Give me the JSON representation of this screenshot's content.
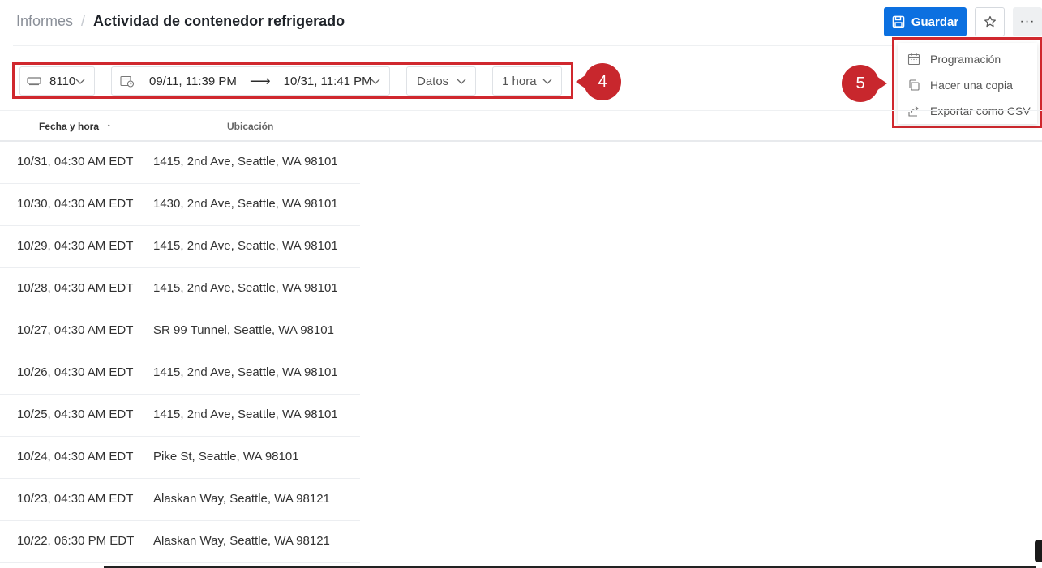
{
  "breadcrumb": {
    "root": "Informes",
    "separator": "/",
    "title": "Actividad de contenedor refrigerado"
  },
  "header": {
    "save_label": "Guardar",
    "more_label": "···"
  },
  "filters": {
    "vehicle": "8110",
    "date_from": "09/11, 11:39 PM",
    "arrow": "⟶",
    "date_to": "10/31, 11:41 PM",
    "data": "Datos",
    "interval": "1 hora"
  },
  "callouts": {
    "four": "4",
    "five": "5"
  },
  "menu": {
    "items": [
      {
        "label": "Programación",
        "icon": "calendar-icon"
      },
      {
        "label": "Hacer una copia",
        "icon": "copy-icon"
      },
      {
        "label": "Exportar como CSV",
        "icon": "export-icon"
      }
    ]
  },
  "table": {
    "columns": {
      "date": "Fecha y hora",
      "sort_arrow": "↑",
      "location": "Ubicación"
    },
    "rows": [
      {
        "date": "10/31, 04:30 AM EDT",
        "location": "1415, 2nd Ave, Seattle, WA 98101"
      },
      {
        "date": "10/30, 04:30 AM EDT",
        "location": "1430, 2nd Ave, Seattle, WA 98101"
      },
      {
        "date": "10/29, 04:30 AM EDT",
        "location": "1415, 2nd Ave, Seattle, WA 98101"
      },
      {
        "date": "10/28, 04:30 AM EDT",
        "location": "1415, 2nd Ave, Seattle, WA 98101"
      },
      {
        "date": "10/27, 04:30 AM EDT",
        "location": "SR 99 Tunnel, Seattle, WA 98101"
      },
      {
        "date": "10/26, 04:30 AM EDT",
        "location": "1415, 2nd Ave, Seattle, WA 98101"
      },
      {
        "date": "10/25, 04:30 AM EDT",
        "location": "1415, 2nd Ave, Seattle, WA 98101"
      },
      {
        "date": "10/24, 04:30 AM EDT",
        "location": "Pike St, Seattle, WA 98101"
      },
      {
        "date": "10/23, 04:30 AM EDT",
        "location": "Alaskan Way, Seattle, WA 98121"
      },
      {
        "date": "10/22, 06:30 PM EDT",
        "location": "Alaskan Way, Seattle, WA 98121"
      }
    ]
  },
  "colors": {
    "accent": "#0c70e0",
    "callout": "#c8272d"
  }
}
